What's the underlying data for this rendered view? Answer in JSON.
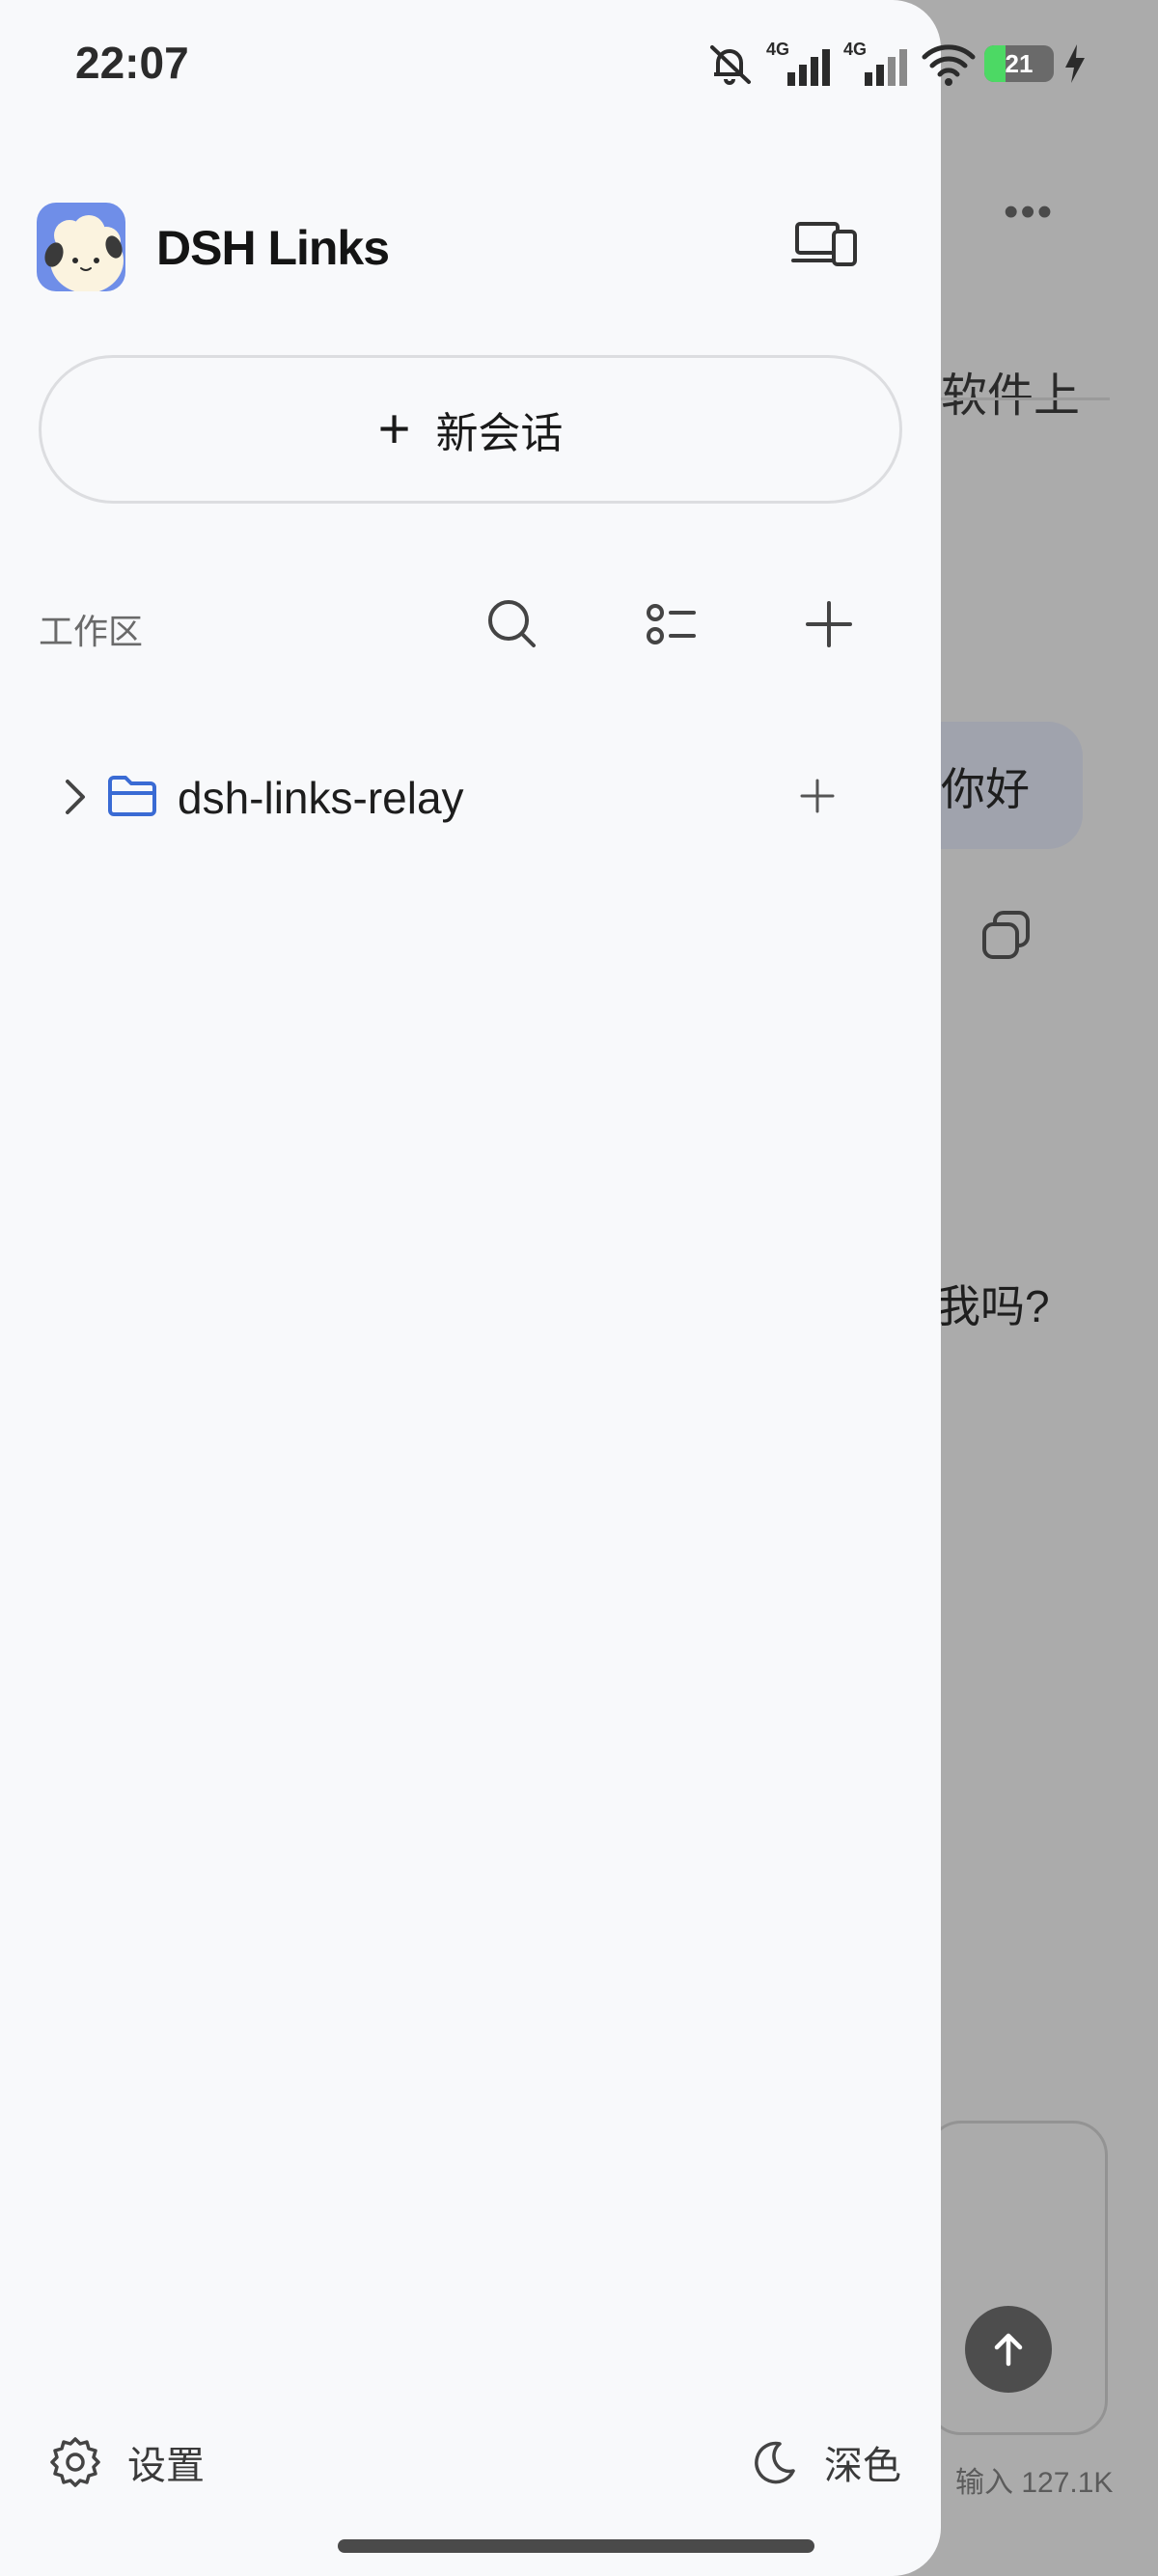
{
  "status_bar": {
    "time": "22:07",
    "network_1": "4G",
    "network_2": "4G",
    "battery_level": "21",
    "icons": [
      "mute-bell-icon",
      "signal-icon",
      "signal-icon",
      "wifi-icon",
      "battery-icon",
      "charging-icon"
    ]
  },
  "drawer": {
    "app_name": "DSH Links",
    "new_chat_label": "新会话",
    "workspace_label": "工作区",
    "folders": [
      {
        "name": "dsh-links-relay"
      }
    ],
    "settings_label": "设置",
    "theme_label": "深色"
  },
  "background_chat": {
    "top_text": "软件上",
    "user_message": "你好",
    "assistant_text": "我吗?",
    "input_stats": "输入 127.1K"
  },
  "colors": {
    "accent": "#3a6bd4",
    "avatar_bg": "#6f8ee8",
    "battery_fill": "#4cd964",
    "drawer_bg": "#f8f9fb",
    "overlay_bg": "#ababab"
  }
}
